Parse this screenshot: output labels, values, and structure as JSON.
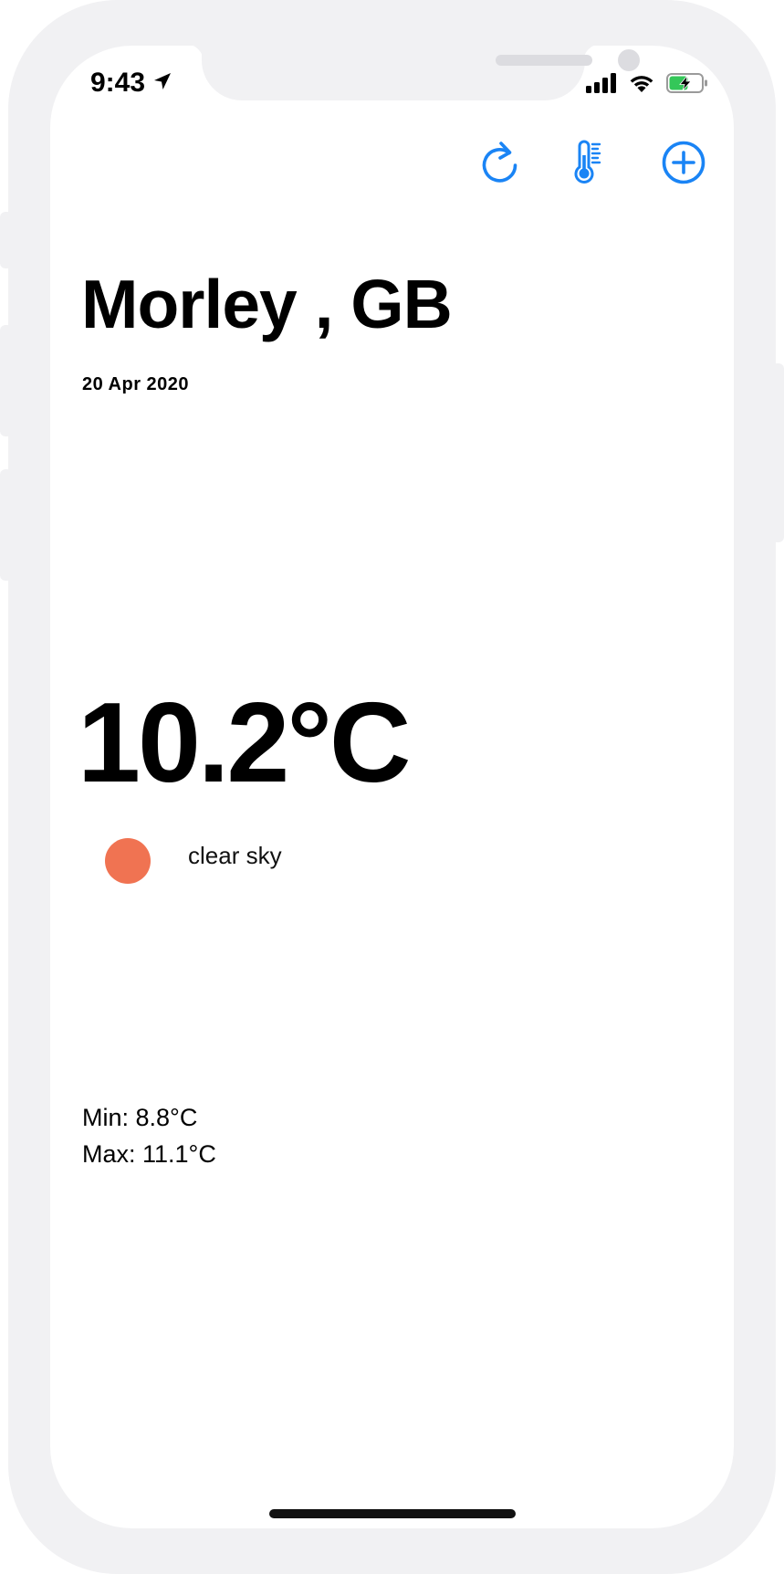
{
  "status_bar": {
    "time": "9:43",
    "icons": [
      "location-arrow-icon",
      "cellular-signal-icon",
      "wifi-icon",
      "battery-charging-icon"
    ]
  },
  "toolbar": {
    "buttons": [
      "refresh-icon",
      "thermometer-icon",
      "add-circle-icon"
    ],
    "accent_color": "#1a84f5"
  },
  "location": {
    "city": "Morley , GB",
    "date": "20 Apr 2020"
  },
  "weather": {
    "temperature": "10.2°C",
    "condition": "clear sky",
    "condition_color": "#f07352",
    "min": "Min: 8.8°C",
    "max": "Max: 11.1°C"
  }
}
